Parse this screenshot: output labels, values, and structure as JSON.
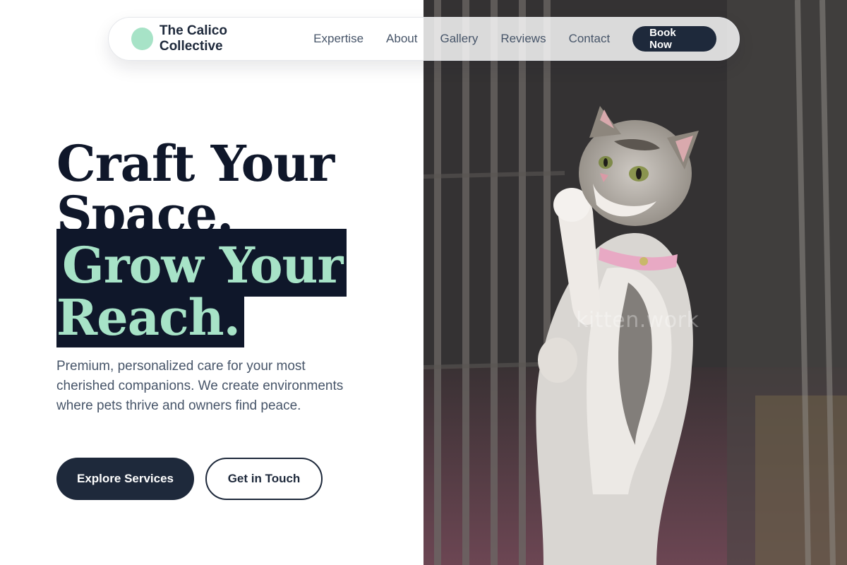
{
  "brand": {
    "name": "The Calico Collective"
  },
  "nav": {
    "links": [
      "Expertise",
      "About",
      "Gallery",
      "Reviews",
      "Contact"
    ],
    "cta": "Book Now"
  },
  "hero": {
    "line1": "Craft Your",
    "line2": "Space.",
    "highlight1": "Grow Your",
    "highlight2": "Reach.",
    "subtitle": "Premium, personalized care for your most cherished companions. We create environments where pets thrive and owners find peace.",
    "primary_button": "Explore Services",
    "secondary_button": "Get in Touch"
  },
  "image": {
    "watermark": "kitten.work"
  },
  "colors": {
    "navy": "#1e293b",
    "mint": "#a7e3c7",
    "ink": "#0f172a",
    "muted": "#475569"
  }
}
